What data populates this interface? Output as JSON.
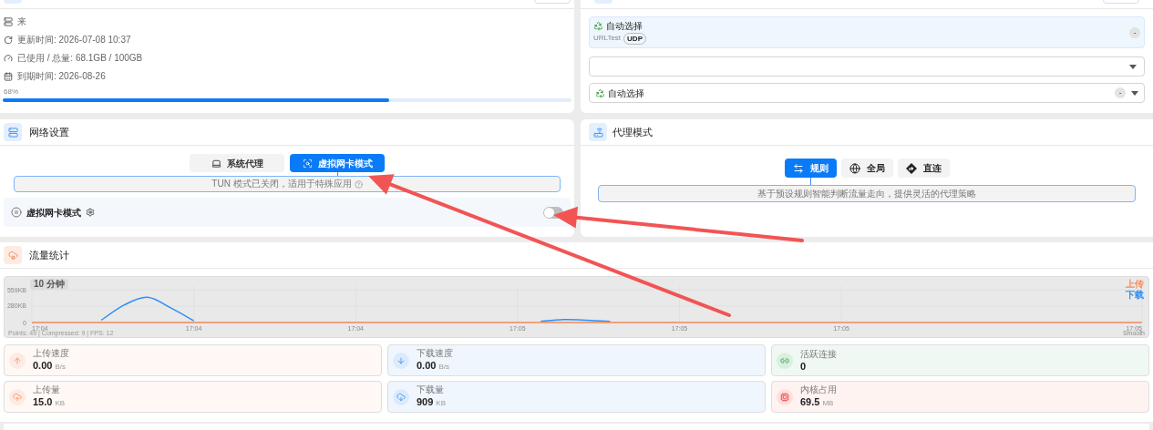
{
  "subscription": {
    "rows": [
      {
        "kind": "source",
        "text": "来"
      },
      {
        "kind": "updated",
        "text": "更新时间: 2026-07-08 10:37"
      },
      {
        "kind": "usage",
        "text": "已使用 / 总量: 68.1GB / 100GB"
      },
      {
        "kind": "expiry",
        "text": "到期时间: 2026-08-26"
      }
    ],
    "percent": "68%",
    "level": 0.68
  },
  "proxy_group": {
    "current": {
      "name": "自动选择",
      "type": "URLTest",
      "tag": "UDP",
      "delay": "-"
    },
    "node_select": {
      "value": "自动选择",
      "delay": "-"
    }
  },
  "network": {
    "title": "网络设置",
    "tabs": [
      {
        "label": "系统代理",
        "selected": false
      },
      {
        "label": "虚拟网卡模式",
        "selected": true
      }
    ],
    "hint": "TUN 模式已关闭，适用于特殊应用",
    "toggle": {
      "label": "虚拟网卡模式",
      "on": false
    }
  },
  "proxy_mode": {
    "title": "代理模式",
    "modes": [
      {
        "kind": "rule",
        "label": "规则",
        "selected": true
      },
      {
        "kind": "global",
        "label": "全局",
        "selected": false
      },
      {
        "kind": "direct",
        "label": "直连",
        "selected": false
      }
    ],
    "hint": "基于预设规则智能判断流量走向，提供灵活的代理策略"
  },
  "traffic": {
    "title": "流量统计",
    "range": "10 分钟",
    "footer": "Points: 49 | Compressed: 9 | FPS: 12",
    "smooth": "Smooth",
    "chart_data": {
      "type": "line",
      "categories": [
        "17:04",
        null,
        null,
        null,
        null,
        null,
        null,
        "17:04",
        null,
        null,
        null,
        null,
        null,
        null,
        "17:04",
        null,
        null,
        null,
        null,
        null,
        null,
        "17:05",
        null,
        null,
        null,
        null,
        null,
        null,
        "17:05",
        null,
        null,
        null,
        null,
        null,
        null,
        "17:05",
        null,
        null,
        null,
        null,
        null,
        null,
        null,
        null,
        null,
        null,
        null,
        null,
        "17:05"
      ],
      "yticks": [
        {
          "value": 0,
          "label": "0"
        },
        {
          "value": 280,
          "label": "280KB"
        },
        {
          "value": 559,
          "label": "559KB"
        }
      ],
      "ylim": [
        0,
        559
      ],
      "grid": true,
      "series": [
        {
          "name": "上传",
          "color": "#f58a5b",
          "values": [
            0,
            0,
            0,
            0,
            0,
            0,
            0,
            0,
            0,
            0,
            0,
            0,
            0,
            0,
            0,
            0,
            0,
            0,
            0,
            0,
            0,
            0,
            0,
            0,
            0,
            0,
            0,
            0,
            0,
            0,
            0,
            0,
            0,
            0,
            0,
            0,
            0,
            0,
            0,
            0,
            0,
            0,
            0,
            0,
            0,
            0,
            0,
            0,
            0
          ]
        },
        {
          "name": "下载",
          "color": "#2f8ef5",
          "values": [
            null,
            null,
            null,
            40,
            300,
            430,
            250,
            30,
            null,
            null,
            null,
            null,
            null,
            null,
            null,
            null,
            null,
            null,
            null,
            null,
            null,
            null,
            20,
            50,
            40,
            20,
            null,
            null,
            null,
            null,
            null,
            null,
            null,
            null,
            null,
            null,
            null,
            null,
            null,
            null,
            null,
            null,
            null,
            null,
            null,
            null,
            null,
            null,
            null
          ]
        }
      ]
    },
    "stats": [
      {
        "kind": "up_speed",
        "label": "上传速度",
        "value": "0.00",
        "unit": "B/s"
      },
      {
        "kind": "down_speed",
        "label": "下载速度",
        "value": "0.00",
        "unit": "B/s"
      },
      {
        "kind": "connections",
        "label": "活跃连接",
        "value": "0"
      },
      {
        "kind": "up_total",
        "label": "上传量",
        "value": "15.0",
        "unit": "KB"
      },
      {
        "kind": "down_total",
        "label": "下载量",
        "value": "909",
        "unit": "KB"
      },
      {
        "kind": "memory",
        "label": "内核占用",
        "value": "69.5",
        "unit": "MB"
      }
    ]
  }
}
